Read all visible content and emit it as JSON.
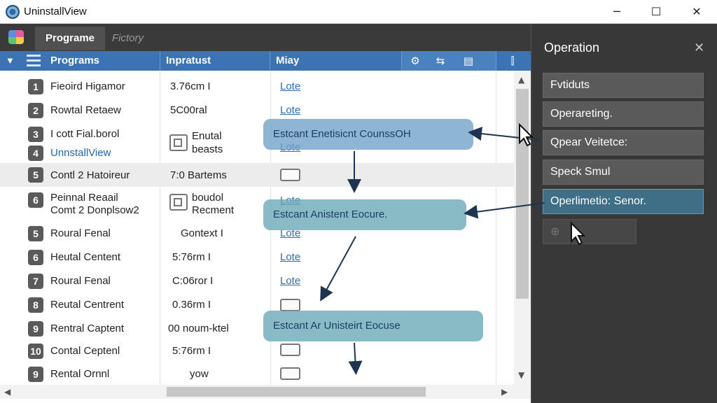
{
  "window": {
    "title": "UninstallView",
    "minimize_glyph": "─",
    "maximize_glyph": "☐",
    "close_glyph": "✕"
  },
  "tabs": {
    "programs": "Programe",
    "history": "Fictory"
  },
  "table": {
    "columns": {
      "programs": "Programs",
      "input": "Inpratust",
      "misc": "Miay"
    },
    "rows": [
      {
        "num": "1",
        "name": "Fieoird Higamor",
        "input": "3.76cm I",
        "link": "Lote"
      },
      {
        "num": "2",
        "name": "Rowtal Retaew",
        "input": "5C00ral",
        "link": "Lote"
      },
      {
        "num": "3",
        "name": "I cott Fial.borol",
        "input_line1": "Enutal",
        "input_line2": "beasts"
      },
      {
        "num": "4",
        "name": "UnnstallView",
        "link": "Lote"
      },
      {
        "num": "5",
        "name": "Contl 2 Hatoireur",
        "input": "7:0 Bartems"
      },
      {
        "num": "6",
        "name_line1": "Peinnal Reaail",
        "name_line2": "Comt 2 Donplsow2",
        "input_line1": "boudol",
        "input_line2": "Recment",
        "link": "Lote"
      },
      {
        "num": "5",
        "name": "Roural Fenal",
        "input": "Gontext I",
        "link": "Lote"
      },
      {
        "num": "6",
        "name": "Heutal Centent",
        "input": "5:76rm I",
        "link": "Lote"
      },
      {
        "num": "7",
        "name": "Roural Fenal",
        "input": "C:06ror I",
        "link": "Lote"
      },
      {
        "num": "8",
        "name": "Reutal Centrent",
        "input": "0.36rm I"
      },
      {
        "num": "9",
        "name": "Rentral Captent",
        "input": "00 noum-ktel"
      },
      {
        "num": "10",
        "name": "Contal Ceptenl",
        "input": "5:76rm I"
      },
      {
        "num": "9",
        "name": "Rental Ornnl",
        "input": "yow"
      }
    ]
  },
  "callouts": [
    "Estcant Enetisicnt CounssOH",
    "Estcant Anistent Eocure.",
    "Estcant Ar Unisteirt Eocuse"
  ],
  "panel": {
    "title": "Operation",
    "close_glyph": "✕",
    "buttons": [
      "Fvtiduts",
      "Operareting.",
      "Qpear Veitetce:",
      "Speck Smul",
      "Operlimetio: Senor."
    ]
  },
  "colors": {
    "header_blue": "#3c73b4",
    "panel_dark": "#383838",
    "link_blue": "#2f6db0",
    "active_button": "#3f6f86"
  }
}
